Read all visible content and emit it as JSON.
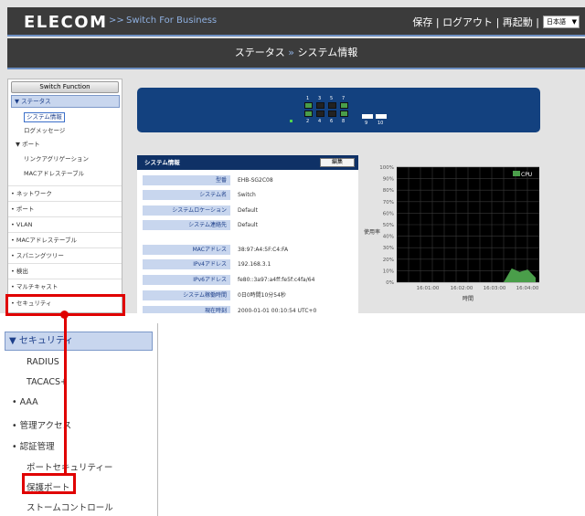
{
  "header": {
    "logo": "ELECOM",
    "logo_sep": ">>",
    "product": "Switch For Business",
    "links": [
      "保存",
      "|",
      "ログアウト",
      "|",
      "再起動",
      "|"
    ],
    "language": "日本語"
  },
  "breadcrumb": {
    "parent": "ステータス",
    "separator": "»",
    "current": "システム情報"
  },
  "sidebar": {
    "title": "Switch Function",
    "items": [
      "▼ ステータス",
      "システム情報",
      "ログメッセージ",
      "▼ ポート",
      "リンクアグリゲーション",
      "MACアドレステーブル",
      "• ネットワーク",
      "• ポート",
      "• VLAN",
      "• MACアドレステーブル",
      "• スパニングツリー",
      "• 検出",
      "• マルチキャスト",
      "• セキュリティ"
    ]
  },
  "switch_panel": {
    "top_ports": [
      "1",
      "3",
      "5",
      "7"
    ],
    "bottom_ports": [
      "2",
      "4",
      "6",
      "8"
    ],
    "sfp_ports": [
      "9",
      "10"
    ],
    "link_up_ports": [
      "1",
      "2",
      "7",
      "8"
    ]
  },
  "system_info": {
    "title": "システム情報",
    "edit_label": "編集",
    "rows": [
      {
        "label": "型番",
        "value": "EHB-SG2C08"
      },
      {
        "label": "システム名",
        "value": "Switch"
      },
      {
        "label": "システムロケーション",
        "value": "Default"
      },
      {
        "label": "システム連絡先",
        "value": "Default"
      },
      {
        "label": "MACアドレス",
        "value": "38:97:A4:5F:C4:FA"
      },
      {
        "label": "IPv4アドレス",
        "value": "192.168.3.1"
      },
      {
        "label": "IPv6アドレス",
        "value": "fe80::3a97:a4ff:fe5f:c4fa/64"
      },
      {
        "label": "システム稼働時間",
        "value": "0日0時間10分54秒"
      },
      {
        "label": "現在時刻",
        "value": "2000-01-01 00:10:54 UTC+0"
      }
    ]
  },
  "cpu_chart": {
    "legend": "CPU",
    "ylabel": "使用率",
    "xlabel": "時間",
    "y_ticks": [
      "100%",
      "90%",
      "80%",
      "70%",
      "60%",
      "50%",
      "40%",
      "30%",
      "20%",
      "10%",
      "0%"
    ],
    "x_ticks": [
      "16:01:00",
      "16:02:00",
      "16:03:00",
      "16:04:00"
    ]
  },
  "chart_data": {
    "type": "area",
    "title": "",
    "xlabel": "時間",
    "ylabel": "使用率",
    "x": [
      "16:03:40",
      "16:03:45",
      "16:03:50",
      "16:03:55",
      "16:04:00"
    ],
    "series": [
      {
        "name": "CPU",
        "values": [
          0,
          12,
          9,
          11,
          4
        ]
      }
    ],
    "ylim": [
      0,
      100
    ],
    "y_unit": "%",
    "color": "#4a9e4a",
    "grid": true,
    "legend_position": "top-right"
  },
  "zoom_menu": {
    "items": [
      "▼ セキュリティ",
      "RADIUS",
      "TACACS+",
      "•  AAA",
      "•  管理アクセス",
      "•  認証管理",
      "ポートセキュリティー",
      "保護ポート",
      "ストームコントロール"
    ]
  },
  "colors": {
    "header_bg": "#3b3b3b",
    "accent_blue": "#0f3166",
    "selection": "#c8d6ee",
    "highlight_red": "#e00000",
    "link_up": "#4a9e4a"
  }
}
